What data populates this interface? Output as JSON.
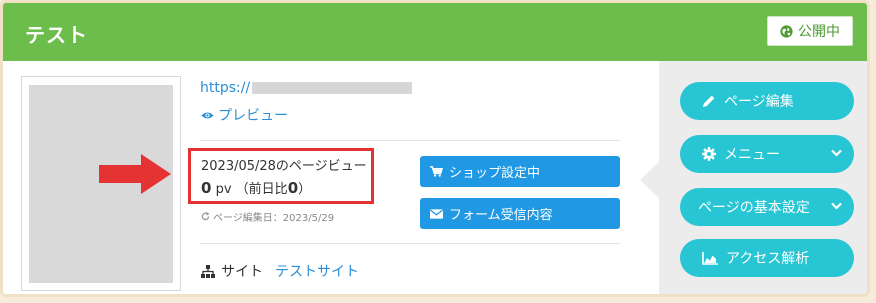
{
  "header": {
    "title": "テスト",
    "status": "公開中",
    "status_color": "#4a9a2c",
    "background": "#6cbd4b"
  },
  "page": {
    "url": "https://",
    "preview_label": "プレビュー",
    "pageview_date_label": "2023/05/28のページビュー",
    "pageview_count": "0",
    "pageview_unit": "pv",
    "compare_prefix": "（前日比",
    "compare_value": "0",
    "compare_suffix": "）",
    "updated_label": "ページ編集日：2023/5/29",
    "site_label": "サイト",
    "site_link": "テストサイト"
  },
  "actions": {
    "shop": "ショップ設定中",
    "form": "フォーム受信内容"
  },
  "sidebar": {
    "edit": "ページ編集",
    "menu": "メニュー",
    "settings": "ページの基本設定",
    "analytics": "アクセス解析"
  },
  "icons": {
    "globe": "globe-icon",
    "eye": "eye-icon",
    "refresh": "refresh-icon",
    "cart": "cart-icon",
    "envelope": "envelope-icon",
    "sitemap": "sitemap-icon",
    "pencil": "pencil-icon",
    "gear": "gear-icon",
    "chevron": "chevron-down-icon",
    "chart": "area-chart-icon",
    "arrow": "arrow-right-icon"
  },
  "colors": {
    "accent_blue": "#2098e4",
    "accent_cyan": "#28c5d5",
    "highlight_red": "#e53232"
  }
}
